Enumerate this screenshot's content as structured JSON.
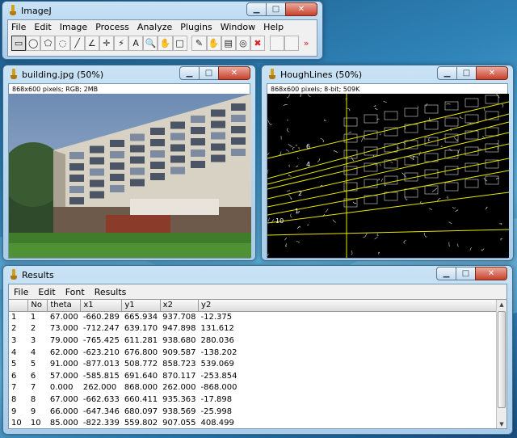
{
  "imagej": {
    "title": "ImageJ",
    "menu": [
      "File",
      "Edit",
      "Image",
      "Process",
      "Analyze",
      "Plugins",
      "Window",
      "Help"
    ],
    "tools": [
      {
        "name": "rectangle-tool-icon",
        "glyph": "▭",
        "active": true
      },
      {
        "name": "oval-tool-icon",
        "glyph": "◯"
      },
      {
        "name": "polygon-tool-icon",
        "glyph": "⬠"
      },
      {
        "name": "freehand-tool-icon",
        "glyph": "◌"
      },
      {
        "name": "line-tool-icon",
        "glyph": "╱"
      },
      {
        "name": "angle-tool-icon",
        "glyph": "∠"
      },
      {
        "name": "point-tool-icon",
        "glyph": "✛"
      },
      {
        "name": "wand-tool-icon",
        "glyph": "⚡"
      },
      {
        "name": "text-tool-icon",
        "glyph": "A"
      },
      {
        "name": "magnifier-tool-icon",
        "glyph": "🔍"
      },
      {
        "name": "hand-tool-icon",
        "glyph": "✋"
      },
      {
        "name": "color-picker-tool-icon",
        "glyph": "□"
      },
      {
        "name": "pencil-tool-icon",
        "glyph": "✎"
      },
      {
        "name": "brush-tool-icon",
        "glyph": "✋"
      },
      {
        "name": "histogram-tool-icon",
        "glyph": "▤"
      },
      {
        "name": "target-tool-icon",
        "glyph": "◎"
      },
      {
        "name": "stop-tool-icon",
        "glyph": "✖"
      },
      {
        "name": "empty-tool-slot",
        "glyph": ""
      },
      {
        "name": "empty-tool-slot",
        "glyph": ""
      },
      {
        "name": "more-tools-icon",
        "glyph": "»"
      }
    ]
  },
  "building": {
    "title": "building.jpg (50%)",
    "info": "868x600 pixels; RGB; 2MB"
  },
  "hough": {
    "title": "HoughLines (50%)",
    "info": "868x600 pixels; 8-bit; 509K",
    "labels": [
      "6",
      "4",
      "2",
      "1",
      "10"
    ],
    "line_color": "#e8e800"
  },
  "results": {
    "title": "Results",
    "menu": [
      "File",
      "Edit",
      "Font",
      "Results"
    ],
    "columns": [
      "",
      "No",
      "theta",
      "x1",
      "y1",
      "x2",
      "y2"
    ],
    "rows": [
      [
        "1",
        "1",
        "67.000",
        "-660.289",
        "665.934",
        "937.708",
        "-12.375"
      ],
      [
        "2",
        "2",
        "73.000",
        "-712.247",
        "639.170",
        "947.898",
        "131.612"
      ],
      [
        "3",
        "3",
        "79.000",
        "-765.425",
        "611.281",
        "938.680",
        "280.036"
      ],
      [
        "4",
        "4",
        "62.000",
        "-623.210",
        "676.800",
        "909.587",
        "-138.202"
      ],
      [
        "5",
        "5",
        "91.000",
        "-877.013",
        "508.772",
        "858.723",
        "539.069"
      ],
      [
        "6",
        "6",
        "57.000",
        "-585.815",
        "691.640",
        "870.117",
        "-253.854"
      ],
      [
        "7",
        "7",
        "0.000",
        "262.000",
        "868.000",
        "262.000",
        "-868.000"
      ],
      [
        "8",
        "8",
        "67.000",
        "-662.633",
        "660.411",
        "935.363",
        "-17.898"
      ],
      [
        "9",
        "9",
        "66.000",
        "-647.346",
        "680.097",
        "938.569",
        "-25.998"
      ],
      [
        "10",
        "10",
        "85.000",
        "-822.339",
        "559.802",
        "907.055",
        "408.499"
      ]
    ]
  },
  "caption": {
    "minimize": "▁",
    "maximize": "□",
    "close": "✕"
  }
}
